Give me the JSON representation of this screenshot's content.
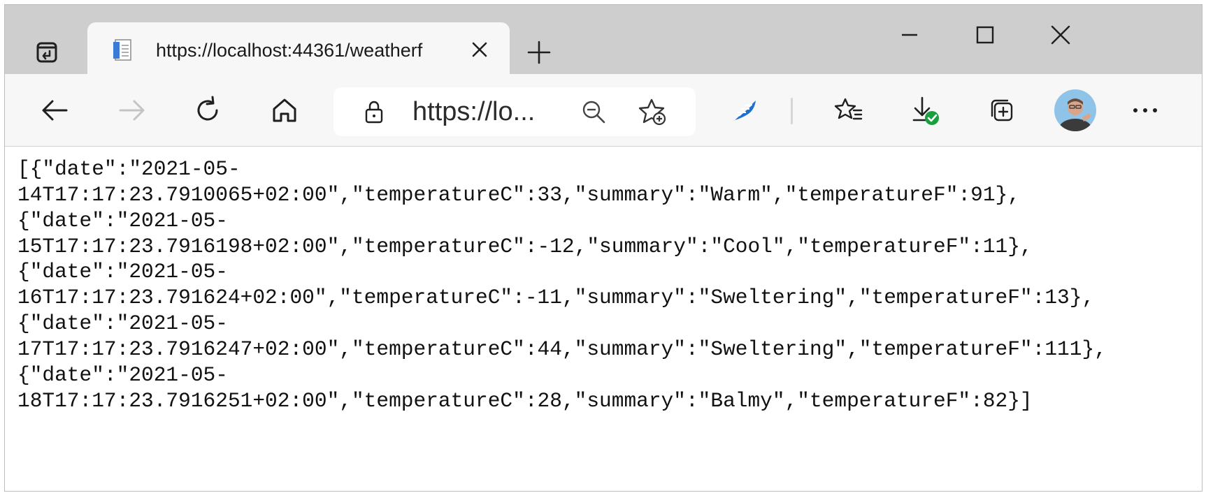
{
  "window": {
    "tab": {
      "title": "https://localhost:44361/weatherf",
      "favicon": "document-icon",
      "close_icon": "close-icon"
    },
    "new_tab_icon": "plus-icon",
    "controls": [
      "minimize-icon",
      "maximize-icon",
      "close-icon"
    ]
  },
  "toolbar": {
    "back_icon": "arrow-left-icon",
    "forward_icon": "arrow-right-icon",
    "refresh_icon": "refresh-icon",
    "home_icon": "home-icon",
    "address": {
      "url": "https://lo...",
      "lock_icon": "lock-icon",
      "zoom_icon": "zoom-out-icon",
      "add_favorite_icon": "star-add-icon"
    },
    "extension_icon": "feather-extension-icon",
    "favorites_icon": "favorites-icon",
    "downloads_icon": "download-complete-icon",
    "collections_icon": "collections-icon",
    "profile_icon": "avatar",
    "menu_icon": "more-icon"
  },
  "content": {
    "lines": [
      "[{\"date\":\"2021-05-",
      "14T17:17:23.7910065+02:00\",\"temperatureC\":33,\"summary\":\"Warm\",\"temperatureF\":91},",
      "{\"date\":\"2021-05-",
      "15T17:17:23.7916198+02:00\",\"temperatureC\":-12,\"summary\":\"Cool\",\"temperatureF\":11},",
      "{\"date\":\"2021-05-",
      "16T17:17:23.791624+02:00\",\"temperatureC\":-11,\"summary\":\"Sweltering\",\"temperatureF\":13},",
      "{\"date\":\"2021-05-",
      "17T17:17:23.7916247+02:00\",\"temperatureC\":44,\"summary\":\"Sweltering\",\"temperatureF\":111},",
      "{\"date\":\"2021-05-",
      "18T17:17:23.7916251+02:00\",\"temperatureC\":28,\"summary\":\"Balmy\",\"temperatureF\":82}]"
    ]
  },
  "colors": {
    "tabstrip": "#cecece",
    "toolbar": "#f7f7f7",
    "accent_blue": "#1e6fd0",
    "download_ok_green": "#1a9e3f"
  }
}
